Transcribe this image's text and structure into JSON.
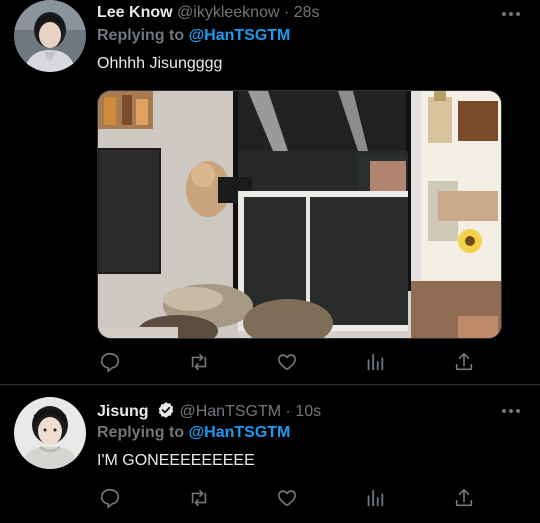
{
  "colors": {
    "background": "#000000",
    "text_primary": "#e7e9ea",
    "text_secondary": "#71767b",
    "accent": "#1d9bf0",
    "divider": "#2f3336"
  },
  "tweets": [
    {
      "display_name": "Lee Know",
      "handle": "@ikykleeknow",
      "separator": "·",
      "time": "28s",
      "reply_prefix": "Replying to",
      "reply_to": "@HanTSGTM",
      "text": "Ohhhh Jisungggg",
      "has_media": true,
      "verified": false,
      "icons": [
        "reply-icon",
        "retweet-icon",
        "like-icon",
        "analytics-icon",
        "share-icon"
      ]
    },
    {
      "display_name": "Jisung",
      "handle": "@HanTSGTM",
      "separator": "·",
      "time": "10s",
      "reply_prefix": "Replying to",
      "reply_to": "@HanTSGTM",
      "text": "I'M GONEEEEEEEEE",
      "has_media": false,
      "verified": true,
      "icons": [
        "reply-icon",
        "retweet-icon",
        "like-icon",
        "analytics-icon",
        "share-icon"
      ]
    }
  ]
}
